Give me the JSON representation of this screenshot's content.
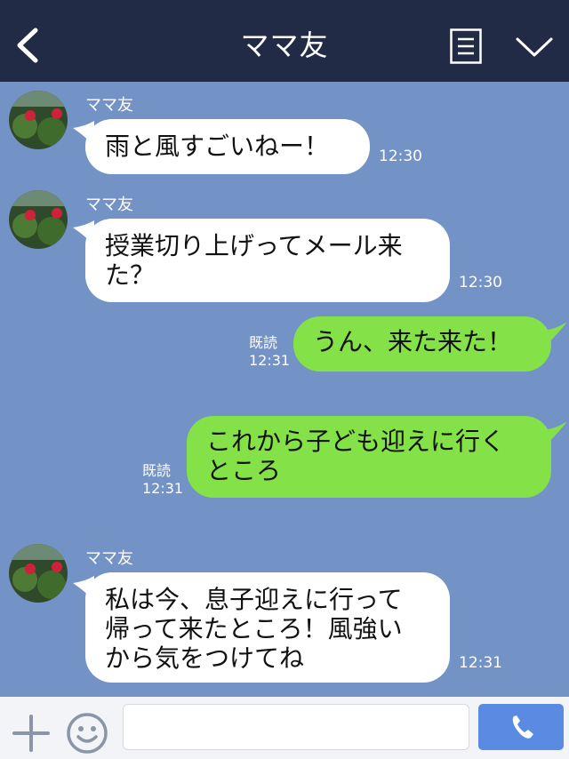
{
  "header": {
    "title": "ママ友"
  },
  "messages": [
    {
      "sender": "ママ友",
      "text": "雨と風すごいねー！",
      "time": "12:30"
    },
    {
      "sender": "ママ友",
      "text": "授業切り上げってメール来\nた？",
      "time": "12:30"
    },
    {
      "read": "既読",
      "text": "うん、来た来た！",
      "time": "12:31"
    },
    {
      "read": "既読",
      "text": "これから子ども迎えに行く\nところ",
      "time": "12:31"
    },
    {
      "sender": "ママ友",
      "text": "私は今、息子迎えに行って\n帰って来たところ！風強い\nから気をつけてね",
      "time": "12:31"
    }
  ],
  "input": {
    "placeholder": ""
  },
  "icons": {
    "back": "chevron-left-icon",
    "menu": "list-icon",
    "collapse": "chevron-down-icon",
    "add": "plus-icon",
    "emoji": "smiley-icon",
    "call": "phone-icon"
  },
  "colors": {
    "header_bg": "#222b45",
    "chat_bg": "#7392c5",
    "incoming_bubble": "#ffffff",
    "outgoing_bubble": "#84e248",
    "call_button": "#5a8ae2"
  }
}
